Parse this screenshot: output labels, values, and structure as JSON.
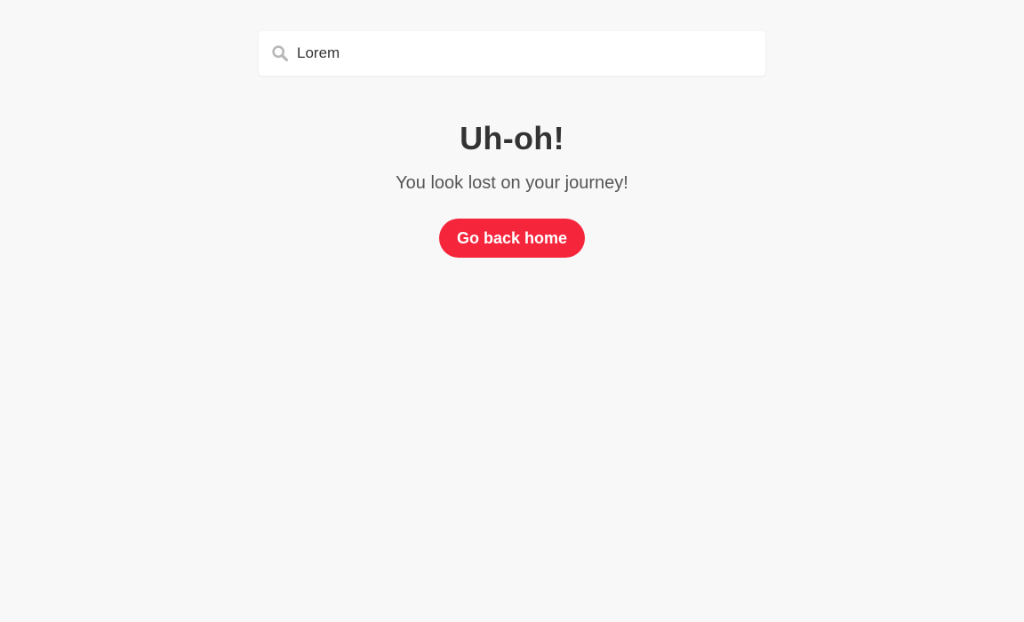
{
  "search": {
    "value": "Lorem",
    "icon": "search-icon"
  },
  "error": {
    "title": "Uh-oh!",
    "message": "You look lost on your journey!",
    "button_label": "Go back home"
  },
  "colors": {
    "background": "#f8f8f8",
    "accent": "#f5253b",
    "text": "#333333",
    "subtext": "#555555",
    "icon": "#b8b8b8"
  }
}
